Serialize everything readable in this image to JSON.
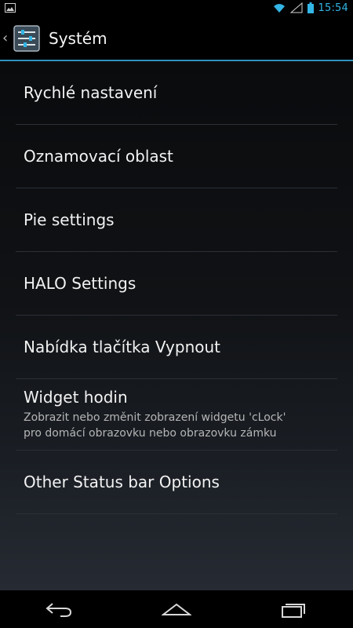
{
  "status_bar": {
    "time": "15:54",
    "icons": [
      "image-icon",
      "wifi-icon",
      "signal-icon",
      "battery-icon"
    ],
    "accent": "#33b5e5"
  },
  "action_bar": {
    "title": "Systém",
    "icon": "settings-sliders-icon",
    "underline_color": "#2f91bf"
  },
  "settings": {
    "items": [
      {
        "label": "Rychlé nastavení"
      },
      {
        "label": "Oznamovací oblast"
      },
      {
        "label": "Pie settings"
      },
      {
        "label": "HALO Settings"
      },
      {
        "label": "Nabídka tlačítka Vypnout"
      },
      {
        "label": "Widget hodin",
        "summary": "Zobrazit nebo změnit zobrazení widgetu 'cLock'\npro domácí obrazovku nebo obrazovku zámku"
      },
      {
        "label": "Other Status bar Options"
      }
    ]
  },
  "nav_bar": {
    "buttons": [
      "back-icon",
      "home-icon",
      "recent-apps-icon"
    ]
  }
}
